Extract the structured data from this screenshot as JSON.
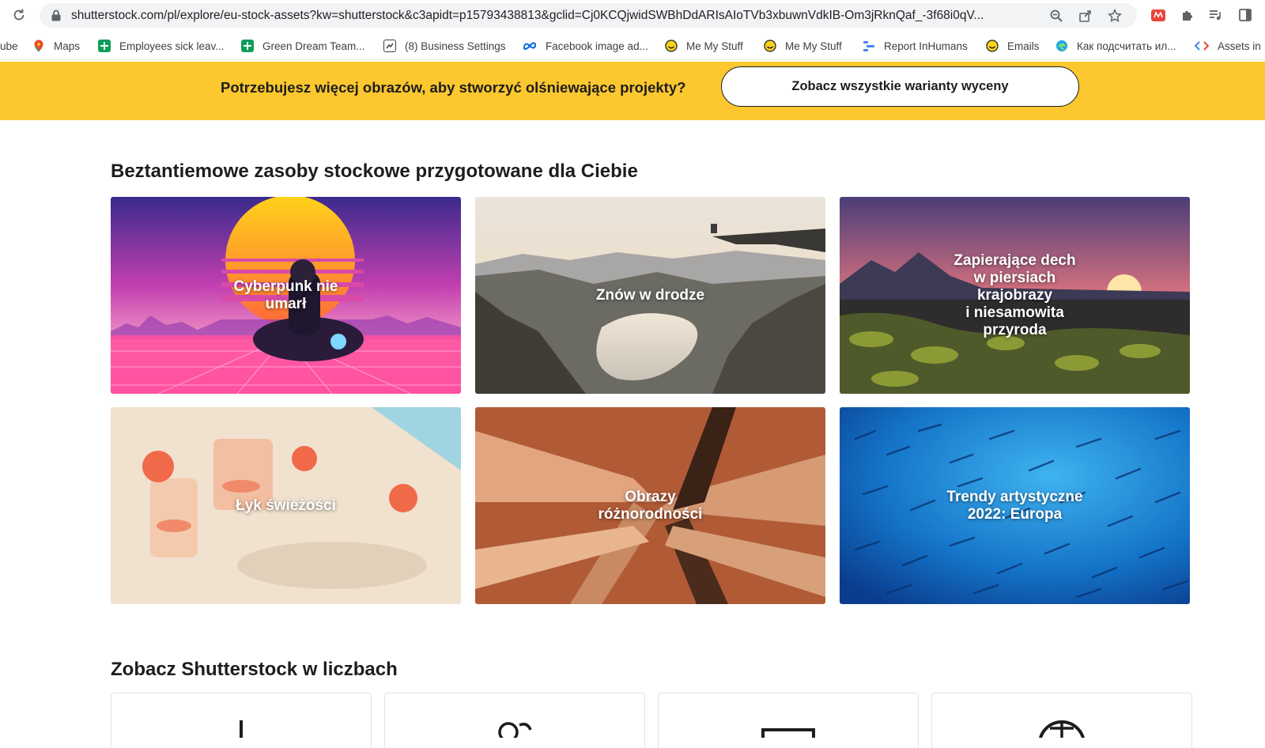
{
  "browser": {
    "url": "shutterstock.com/pl/explore/eu-stock-assets?kw=shutterstock&c3apidt=p15793438813&gclid=Cj0KCQjwidSWBhDdARIsAIoTVb3xbuwnVdkIB-Om3jRknQaf_-3f68i0qV...",
    "toolbar_icons": [
      "reload-icon",
      "lock-icon",
      "zoom-icon",
      "share-icon",
      "star-icon",
      "extension-app-icon",
      "puzzle-icon",
      "media-icon",
      "sidepanel-icon"
    ]
  },
  "bookmarks": [
    {
      "label": "ube",
      "icon": "youtube-icon"
    },
    {
      "label": "Maps",
      "icon": "maps-icon"
    },
    {
      "label": "Employees sick leav...",
      "icon": "sheets-icon"
    },
    {
      "label": "Green Dream Team...",
      "icon": "sheets-icon"
    },
    {
      "label": "(8) Business Settings",
      "icon": "business-icon"
    },
    {
      "label": "Facebook image ad...",
      "icon": "meta-icon"
    },
    {
      "label": "Me My Stuff",
      "icon": "smiley-icon"
    },
    {
      "label": "Me My Stuff",
      "icon": "smiley-icon"
    },
    {
      "label": "Report InHumans",
      "icon": "report-icon"
    },
    {
      "label": "Emails",
      "icon": "smiley-icon"
    },
    {
      "label": "Как подсчитать ил...",
      "icon": "edge-icon"
    },
    {
      "label": "Assets in",
      "icon": "code-icon"
    }
  ],
  "promo": {
    "text": "Potrzebujesz więcej obrazów, aby stworzyć olśniewające projekty?",
    "button": "Zobacz wszystkie warianty wyceny",
    "color": "#fcc72f"
  },
  "collections": {
    "title": "Beztantiemowe zasoby stockowe przygotowane dla Ciebie",
    "tiles": [
      {
        "caption": "Cyberpunk nie\numarł",
        "theme": "cyberpunk"
      },
      {
        "caption": "Znów w drodze",
        "theme": "mountains"
      },
      {
        "caption": "Zapierające dech\nw piersiach\nkrajobrazy\ni niesamowita\nprzyroda",
        "theme": "landscape"
      },
      {
        "caption": "Łyk świeżości",
        "theme": "drinks"
      },
      {
        "caption": "Obrazy\nróżnorodności",
        "theme": "hands"
      },
      {
        "caption": "Trendy artystyczne\n2022: Europa",
        "theme": "fish"
      }
    ]
  },
  "stats": {
    "title": "Zobacz Shutterstock w liczbach",
    "cards": [
      {
        "icon": "image-count-icon"
      },
      {
        "icon": "users-icon"
      },
      {
        "icon": "monitor-icon"
      },
      {
        "icon": "globe-icon"
      }
    ]
  }
}
